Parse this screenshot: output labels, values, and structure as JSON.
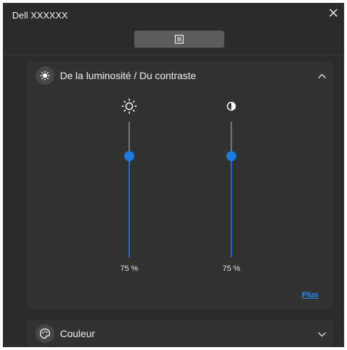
{
  "window": {
    "title": "Dell XXXXXX"
  },
  "brightness_panel": {
    "title": "De la luminosité / Du contraste",
    "brightness": {
      "value_label": "75 %",
      "level": 0.75,
      "icon": "sun-icon"
    },
    "contrast": {
      "value_label": "75 %",
      "level": 0.75,
      "icon": "contrast-icon"
    },
    "more_link": "Plus"
  },
  "color_panel": {
    "title": "Couleur"
  },
  "colors": {
    "accent": "#1a7ae0",
    "link": "#2a8bf2",
    "background": "#2b2b2b",
    "panel": "#323232"
  }
}
